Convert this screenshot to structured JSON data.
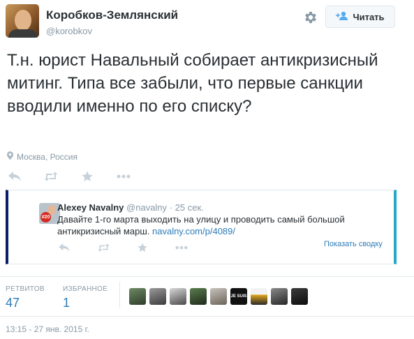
{
  "header": {
    "display_name": "Коробков-Землянский",
    "handle": "@korobkov",
    "follow_label": "Читать"
  },
  "tweet": {
    "text": "Т.н. юрист Навальный собирает антикризисный митинг. Типа все забыли, что первые санкции вводили именно по его списку?",
    "location": "Москва, Россия"
  },
  "quoted": {
    "name": "Alexey Navalny",
    "handle": "@navalny",
    "separator": "·",
    "time": "25 сек.",
    "text": "Давайте 1-го марта выходить на улицу и проводить самый большой антикризисный марш.",
    "link": "navalny.com/p/4089/",
    "avatar_badge": "#20",
    "show_summary": "Показать сводку"
  },
  "stats": {
    "retweets_label": "РЕТВИТОВ",
    "retweets_value": "47",
    "favorites_label": "ИЗБРАННОЕ",
    "favorites_value": "1"
  },
  "favoriters": [
    {
      "label": ""
    },
    {
      "label": ""
    },
    {
      "label": ""
    },
    {
      "label": ""
    },
    {
      "label": ""
    },
    {
      "label": "JE SUIS"
    },
    {
      "label": ""
    },
    {
      "label": ""
    },
    {
      "label": ""
    }
  ],
  "timestamp": "13:15 - 27 янв. 2015 г.",
  "colors": {
    "link": "#2b7bb9",
    "muted": "#8899a6",
    "text": "#292f33",
    "quote_left_border": "#0a1f66",
    "quote_right_border": "#24a8c8"
  },
  "icons": [
    "gear-icon",
    "follow-person-icon",
    "location-pin-icon",
    "reply-icon",
    "retweet-icon",
    "favorite-star-icon",
    "more-icon"
  ]
}
